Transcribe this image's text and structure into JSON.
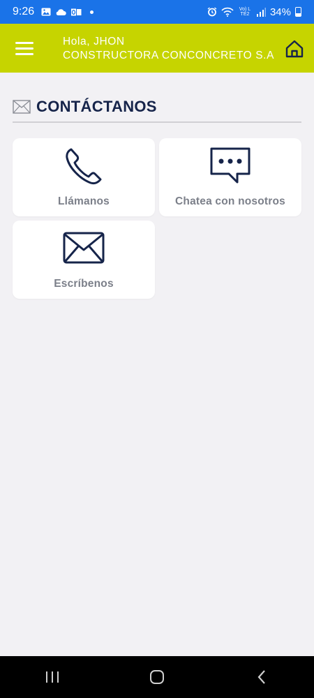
{
  "status_bar": {
    "time": "9:26",
    "battery": "34%",
    "lte_label": "Vo) LTE2",
    "icons": [
      "image-icon",
      "cloud-icon",
      "outlook-icon",
      "alarm-icon",
      "wifi-icon",
      "signal-icon",
      "battery-icon"
    ]
  },
  "header": {
    "greeting": "Hola, JHON",
    "company": "CONSTRUCTORA CONCONCRETO S.A",
    "menu_icon": "hamburger-icon",
    "home_icon": "home-icon",
    "color": "#c6d400"
  },
  "section": {
    "title": "CONTÁCTANOS",
    "icon": "envelope-icon"
  },
  "options": [
    {
      "label": "Llámanos",
      "icon": "phone-icon"
    },
    {
      "label": "Chatea con nosotros",
      "icon": "chat-icon"
    },
    {
      "label": "Escríbenos",
      "icon": "envelope-icon"
    }
  ],
  "nav_bar": {
    "icons": [
      "recents-icon",
      "home-circle-icon",
      "back-icon"
    ]
  },
  "colors": {
    "status_bar": "#1a73e8",
    "title": "#16244a",
    "label": "#7b7f89",
    "background": "#f2f1f4"
  }
}
